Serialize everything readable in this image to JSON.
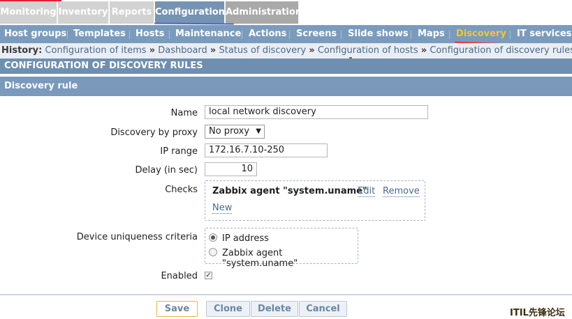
{
  "top_tabs": [
    {
      "label": "Monitoring"
    },
    {
      "label": "Inventory"
    },
    {
      "label": "Reports"
    },
    {
      "label": "Configuration"
    },
    {
      "label": "Administration"
    }
  ],
  "sub_tabs": [
    {
      "label": "Host groups"
    },
    {
      "label": "Templates"
    },
    {
      "label": "Hosts"
    },
    {
      "label": "Maintenance"
    },
    {
      "label": "Actions"
    },
    {
      "label": "Screens"
    },
    {
      "label": "Slide shows"
    },
    {
      "label": "Maps"
    },
    {
      "label": "Discovery"
    },
    {
      "label": "IT services"
    }
  ],
  "history": {
    "label": "History:",
    "items": [
      "Configuration of items",
      "Dashboard",
      "Status of discovery",
      "Configuration of hosts",
      "Configuration of discovery rules"
    ],
    "separator": "»"
  },
  "page_header": "CONFIGURATION OF DISCOVERY RULES",
  "section_header": "Discovery rule",
  "form": {
    "name_label": "Name",
    "name_value": "local network discovery",
    "proxy_label": "Discovery by proxy",
    "proxy_value": "No proxy",
    "ip_range_label": "IP range",
    "ip_range_value": "172.16.7.10-250",
    "delay_label": "Delay (in sec)",
    "delay_value": "10",
    "checks_label": "Checks",
    "check_name": "Zabbix agent \"system.uname\"",
    "check_edit": "Edit",
    "check_remove": "Remove",
    "check_new": "New",
    "uniqueness_label": "Device uniqueness criteria",
    "uniqueness_options": [
      "IP address",
      "Zabbix agent \"system.uname\""
    ],
    "enabled_label": "Enabled",
    "enabled_check": "✓"
  },
  "buttons": {
    "save": "Save",
    "clone": "Clone",
    "delete": "Delete",
    "cancel": "Cancel"
  },
  "watermark": "ITIL先锋论坛",
  "colors": {
    "active_tab": "#7593b3",
    "subnav": "#7b9bbd",
    "active_subtab": "#f7c237",
    "link": "#496a8d"
  }
}
